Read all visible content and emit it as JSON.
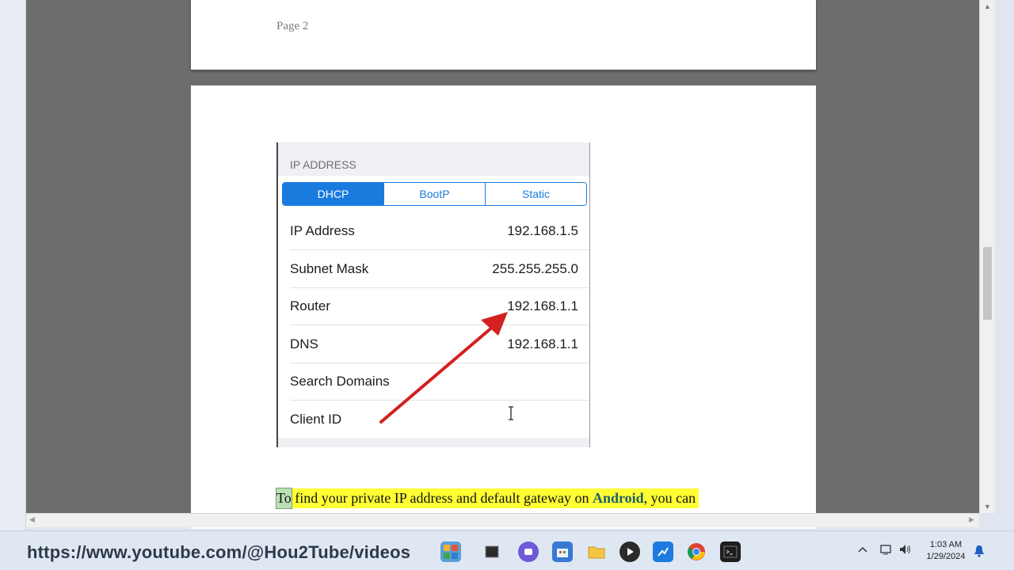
{
  "document": {
    "page1_label": "Page 2",
    "ios_screenshot": {
      "section_header": "IP ADDRESS",
      "segments": [
        {
          "label": "DHCP",
          "active": true
        },
        {
          "label": "BootP",
          "active": false
        },
        {
          "label": "Static",
          "active": false
        }
      ],
      "rows": [
        {
          "label": "IP Address",
          "value": "192.168.1.5"
        },
        {
          "label": "Subnet Mask",
          "value": "255.255.255.0"
        },
        {
          "label": "Router",
          "value": "192.168.1.1"
        },
        {
          "label": "DNS",
          "value": "192.168.1.1"
        },
        {
          "label": "Search Domains",
          "value": ""
        },
        {
          "label": "Client ID",
          "value": ""
        }
      ]
    },
    "body_text": {
      "first_word": "To",
      "part1": " find your private IP address and default gateway on ",
      "bold": "Android",
      "part2": ", you can"
    }
  },
  "overlay_url": "https://www.youtube.com/@Hou2Tube/videos",
  "taskbar": {
    "clock_time": "1:03 AM",
    "clock_date": "1/29/2024",
    "icons": [
      "widgets-icon",
      "terminal-window-icon",
      "teams-chat-icon",
      "store-icon",
      "file-explorer-icon",
      "media-player-icon",
      "whiteboard-icon",
      "chrome-icon",
      "command-prompt-icon"
    ]
  },
  "colors": {
    "accent": "#1a7bde",
    "highlight": "#ffff33",
    "arrow": "#d42020"
  }
}
